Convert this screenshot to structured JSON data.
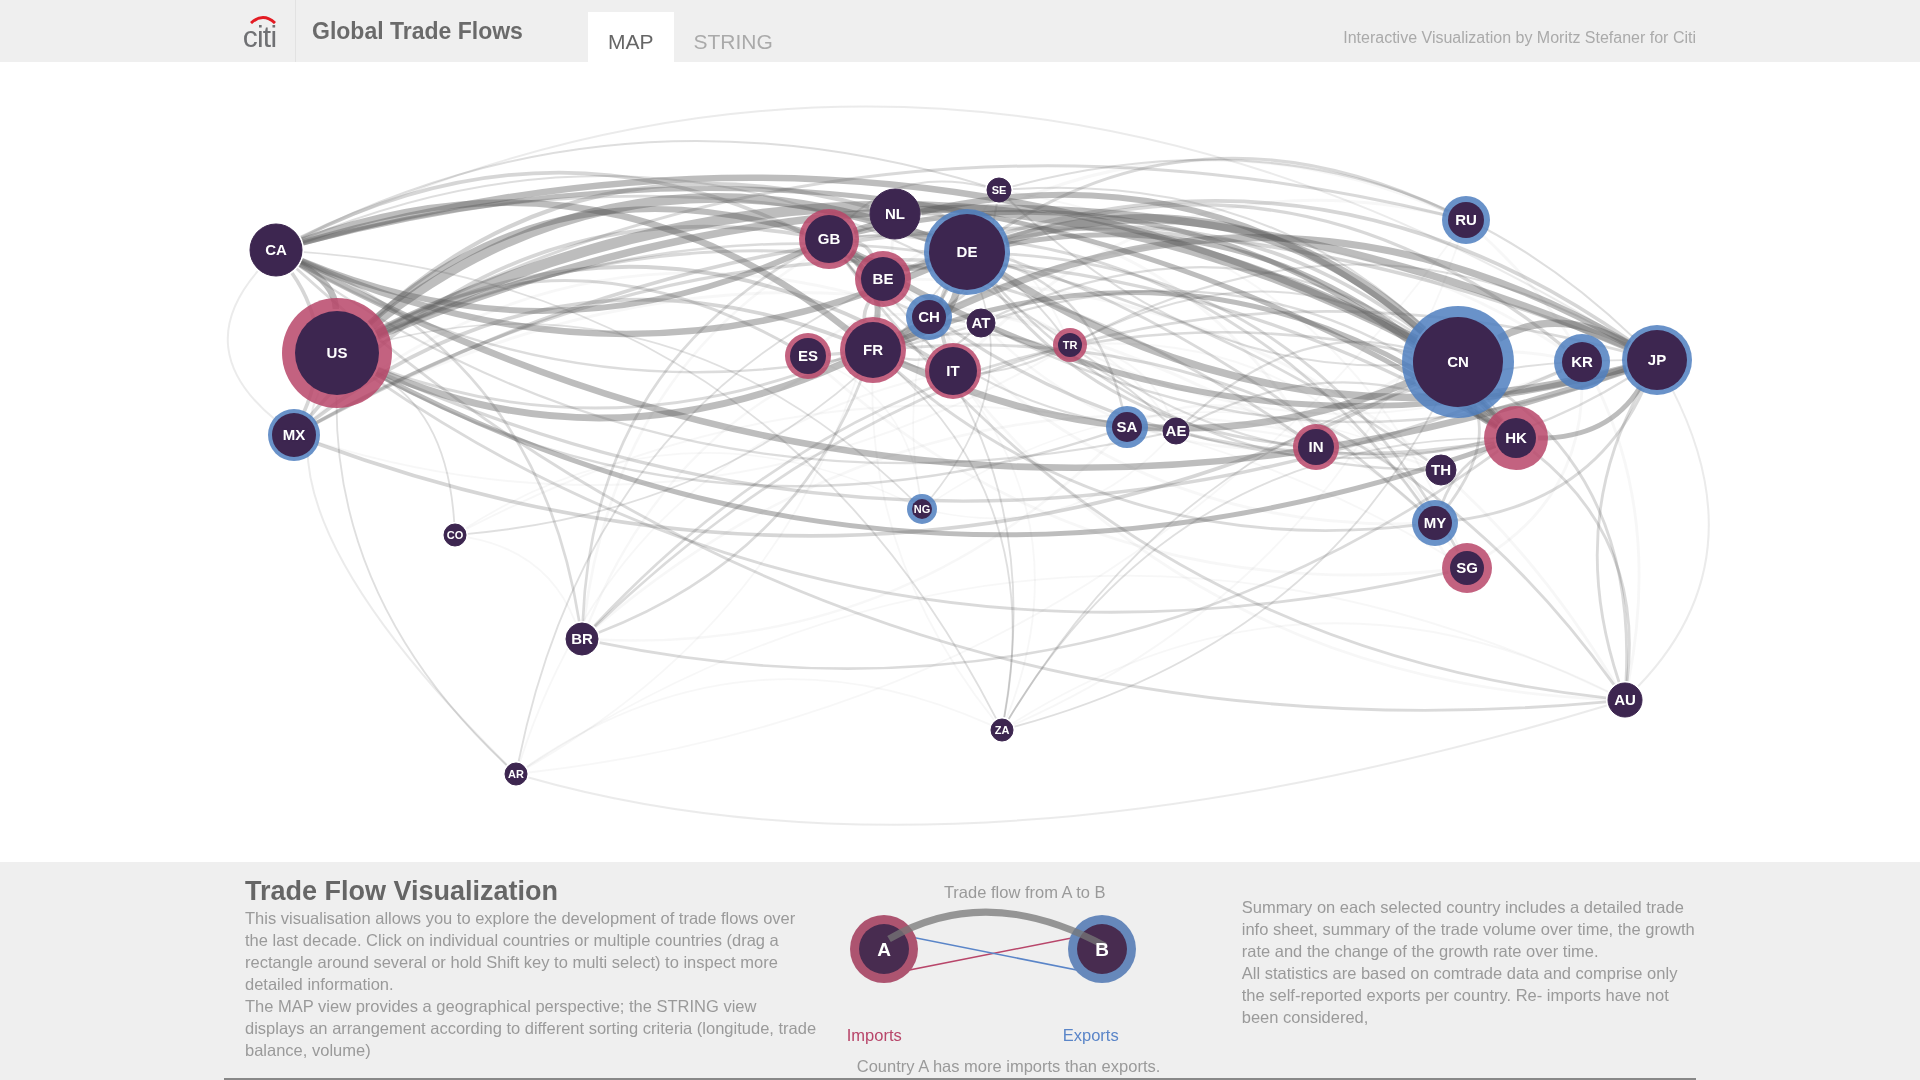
{
  "header": {
    "logo": "citi",
    "title": "Global Trade Flows",
    "tabs": [
      {
        "label": "MAP",
        "selected": true
      },
      {
        "label": "STRING",
        "selected": false
      }
    ],
    "credit": "Interactive Visualization by Moritz Stefaner for Citi"
  },
  "map": {
    "countries": [
      {
        "code": "CA",
        "kind": "neutral"
      },
      {
        "code": "US",
        "kind": "importer"
      },
      {
        "code": "MX",
        "kind": "exporter"
      },
      {
        "code": "CO",
        "kind": "neutral"
      },
      {
        "code": "BR",
        "kind": "neutral"
      },
      {
        "code": "AR",
        "kind": "neutral"
      },
      {
        "code": "GB",
        "kind": "importer"
      },
      {
        "code": "NL",
        "kind": "neutral"
      },
      {
        "code": "SE",
        "kind": "neutral"
      },
      {
        "code": "DE",
        "kind": "exporter"
      },
      {
        "code": "BE",
        "kind": "importer"
      },
      {
        "code": "CH",
        "kind": "exporter"
      },
      {
        "code": "AT",
        "kind": "neutral"
      },
      {
        "code": "ES",
        "kind": "importer"
      },
      {
        "code": "FR",
        "kind": "importer"
      },
      {
        "code": "IT",
        "kind": "importer"
      },
      {
        "code": "TR",
        "kind": "importer"
      },
      {
        "code": "SA",
        "kind": "exporter"
      },
      {
        "code": "AE",
        "kind": "neutral"
      },
      {
        "code": "NG",
        "kind": "exporter"
      },
      {
        "code": "ZA",
        "kind": "neutral"
      },
      {
        "code": "IN",
        "kind": "importer"
      },
      {
        "code": "CN",
        "kind": "exporter"
      },
      {
        "code": "KR",
        "kind": "exporter"
      },
      {
        "code": "JP",
        "kind": "exporter"
      },
      {
        "code": "RU",
        "kind": "exporter"
      },
      {
        "code": "HK",
        "kind": "importer"
      },
      {
        "code": "TH",
        "kind": "neutral"
      },
      {
        "code": "MY",
        "kind": "exporter"
      },
      {
        "code": "SG",
        "kind": "importer"
      },
      {
        "code": "AU",
        "kind": "neutral"
      }
    ]
  },
  "info": {
    "title": "Trade Flow Visualization",
    "paragraphs": [
      "This visualisation allows you to explore the development of trade flows over the last decade. Click on individual countries or multiple countries (drag a rectangle around several or hold Shift key to multi select) to inspect more detailed information.",
      "The MAP view provides a geographical perspective; the STRING view displays an arrangement according to different sorting criteria (longitude, trade balance, volume)"
    ],
    "legend": {
      "title": "Trade flow from A to B",
      "nodes": [
        "A",
        "B"
      ],
      "imports_label": "Imports",
      "exports_label": "Exports",
      "caption": "Country A has more imports than exports."
    },
    "notes": [
      "Summary on each selected country includes a detailed trade info sheet, summary of the trade volume over time, the growth rate and the change of the growth rate over time.",
      "All statistics are based on comtrade data and comprise only the self-reported exports per country. Re- imports have not been considered,"
    ]
  }
}
